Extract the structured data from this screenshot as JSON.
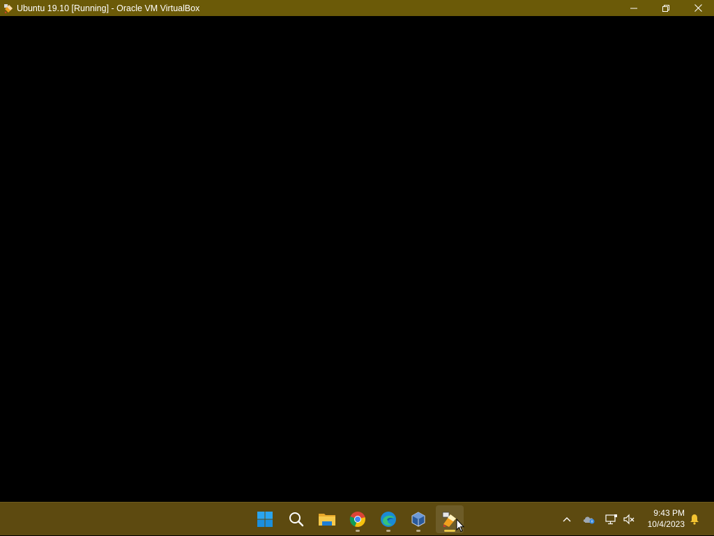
{
  "window": {
    "title": "Ubuntu 19.10 [Running] - Oracle VM VirtualBox",
    "icon": "virtualbox-vm-icon",
    "controls": [
      "minimize",
      "restore",
      "close"
    ]
  },
  "vm_display": {
    "state": "blank"
  },
  "taskbar": {
    "apps": [
      {
        "name": "Start",
        "icon": "windows-start-icon",
        "running": false
      },
      {
        "name": "Search",
        "icon": "search-icon",
        "running": false
      },
      {
        "name": "File Explorer",
        "icon": "folder-icon",
        "running": false
      },
      {
        "name": "Google Chrome",
        "icon": "chrome-icon",
        "running": true
      },
      {
        "name": "Microsoft Edge",
        "icon": "edge-icon",
        "running": true
      },
      {
        "name": "Oracle VM VirtualBox",
        "icon": "virtualbox-icon",
        "running": true
      },
      {
        "name": "Ubuntu 19.10 [Running] - Oracle VM VirtualBox",
        "icon": "virtualbox-vm-icon",
        "running": true,
        "active": true
      }
    ],
    "tray": {
      "icons": [
        "chevron-up-icon",
        "onedrive-icon",
        "network-icon",
        "volume-muted-icon",
        "notification-bell-icon"
      ]
    },
    "clock": {
      "time": "9:43 PM",
      "date": "10/4/2023"
    }
  },
  "colors": {
    "titlebar": "#6b5a08",
    "taskbar": "#5d4a10",
    "accent": "#e9c94a"
  }
}
